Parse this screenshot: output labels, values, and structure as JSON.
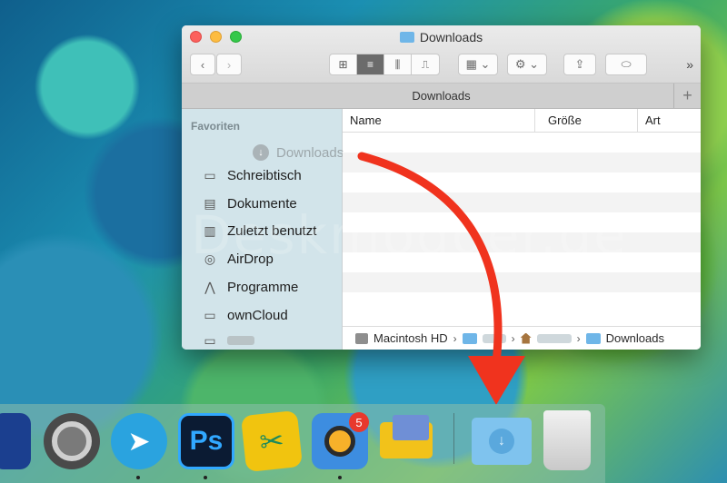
{
  "window": {
    "title": "Downloads",
    "tab_label": "Downloads",
    "tab_add": "+",
    "more": "»",
    "toolbar": {
      "back": "‹",
      "forward": "›",
      "view_icons": "⊞",
      "view_list": "≡",
      "view_columns": "⫼",
      "view_coverflow": "⎍",
      "arrange": "▦ ⌄",
      "action": "⚙ ⌄",
      "share": "⇪",
      "tag": "⬭"
    }
  },
  "sidebar": {
    "section": "Favoriten",
    "dragging": "Downloads",
    "items": [
      {
        "label": "Schreibtisch",
        "icon": "desktop-icon"
      },
      {
        "label": "Dokumente",
        "icon": "documents-icon"
      },
      {
        "label": "Zuletzt benutzt",
        "icon": "recents-icon"
      },
      {
        "label": "AirDrop",
        "icon": "airdrop-icon"
      },
      {
        "label": "Programme",
        "icon": "applications-icon"
      },
      {
        "label": "ownCloud",
        "icon": "folder-icon"
      }
    ]
  },
  "columns": {
    "name": "Name",
    "size": "Größe",
    "kind": "Art"
  },
  "pathbar": {
    "disk": "Macintosh HD",
    "folder": "Downloads"
  },
  "watermark": "Deskmodder.de",
  "dock": {
    "badge": "5",
    "ps_label": "Ps"
  },
  "colors": {
    "arrow": "#f0331e",
    "folder": "#6fb6e8",
    "close": "#fc605c",
    "minimize": "#fdbc40",
    "maximize": "#34c84a"
  }
}
